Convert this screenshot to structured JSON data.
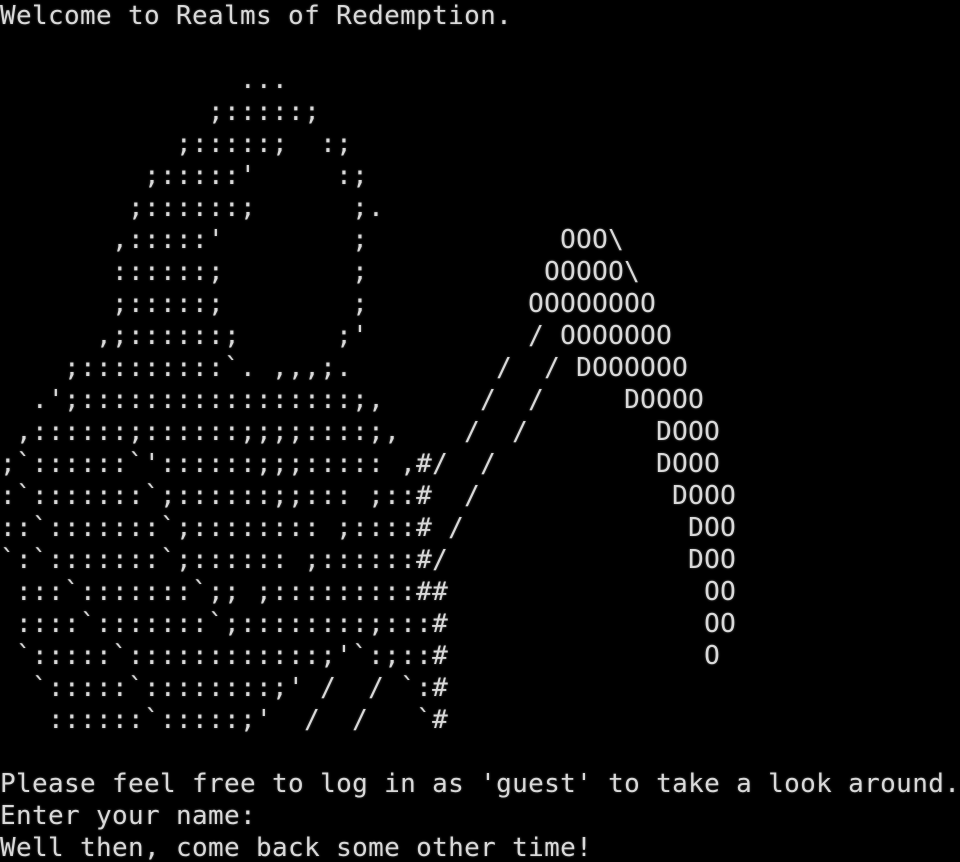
{
  "terminal": {
    "foreground": "#d9d9d9",
    "background": "#000000",
    "welcome": "Welcome to Realms of Redemption.",
    "art_lines": [
      "               ...",
      "             ;:::::;",
      "           ;:::::;  :;",
      "         ;:::::'     :;",
      "        ;::::::;      ;.",
      "       ,:::::'        ;            OOO\\",
      "       ::::::;        ;           OOOOO\\",
      "       ;:::::;        ;          OOOOOOOO",
      "      ,;::::::;      ;'          / OOOOOOO",
      "    ;:::::::::`. ,,,;.         /  / DOOOOOO",
      "  .';:::::::::::::::::;,      /  /     DOOOO",
      " ,::::::;::::::;;;;::::;,    /  /        DOOO",
      ";`::::::`'::::::;;;::::: ,#/  /          DOOO",
      ":`:::::::`;::::::;;::: ;::#  /            DOOO",
      "::`:::::::`;:::::::: ;::::# /              DOO",
      "`:`:::::::`;:::::: ;::::::#/               DOO",
      " :::`:::::::`;; ;:::::::::##                OO",
      " ::::`:::::::`;::::::::;:::#                OO",
      " `:::::`::::::::::::;'`:;::#                O",
      "  `:::::`::::::::;' /  / `:#",
      "   ::::::`:::::;'  /  /   `#"
    ],
    "guest_prompt": "Please feel free to log in as 'guest' to take a look around.",
    "name_prompt": "Enter your name:",
    "goodbye": "Well then, come back some other time!"
  }
}
